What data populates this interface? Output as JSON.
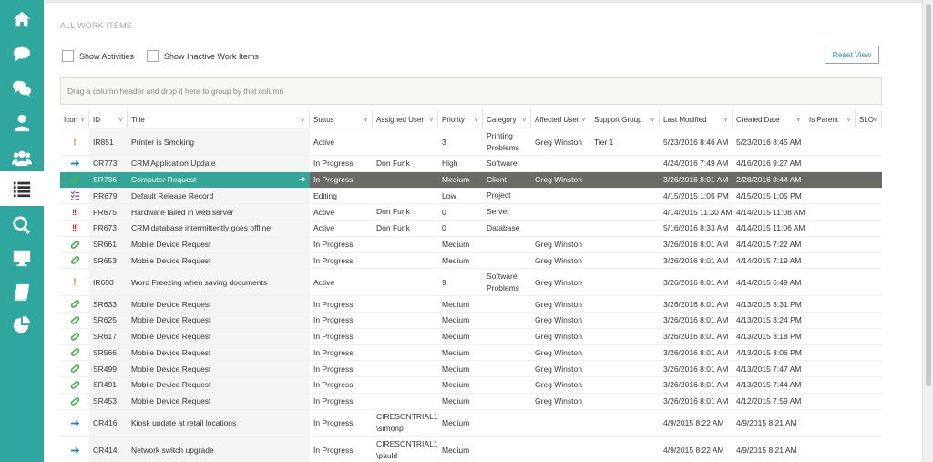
{
  "nav": [
    {
      "name": "home",
      "icon": "home-icon"
    },
    {
      "name": "chat",
      "icon": "chat-bubble-icon"
    },
    {
      "name": "conversations",
      "icon": "chat-bubbles-icon"
    },
    {
      "name": "profile",
      "icon": "user-icon"
    },
    {
      "name": "groups",
      "icon": "users-icon"
    },
    {
      "name": "work-items",
      "icon": "list-icon",
      "active": true
    },
    {
      "name": "search",
      "icon": "search-icon"
    },
    {
      "name": "monitor",
      "icon": "monitor-icon"
    },
    {
      "name": "knowledge",
      "icon": "book-icon"
    },
    {
      "name": "reports",
      "icon": "pie-chart-icon"
    }
  ],
  "page": {
    "title": "ALL WORK ITEMS",
    "show_activities_label": "Show Activities",
    "show_inactive_label": "Show Inactive Work Items",
    "reset_label": "Reset View",
    "group_hint": "Drag a column header and drop it here to group by that column"
  },
  "colors": {
    "sidebar": "#2fa79e",
    "selected_row": "#6b6b66",
    "selected_accent": "#35a597",
    "incident": "#f08a24",
    "problem": "#d9262b",
    "change": "#1e7fc4",
    "service_request": "#4caf50",
    "release": "#7b4fb5"
  },
  "columns": [
    {
      "key": "icon",
      "label": "Icon"
    },
    {
      "key": "id",
      "label": "ID"
    },
    {
      "key": "title",
      "label": "Title"
    },
    {
      "key": "status",
      "label": "Status"
    },
    {
      "key": "assigned",
      "label": "Assigned User"
    },
    {
      "key": "priority",
      "label": "Priority"
    },
    {
      "key": "category",
      "label": "Category"
    },
    {
      "key": "affected",
      "label": "Affected User"
    },
    {
      "key": "group",
      "label": "Support Group"
    },
    {
      "key": "modified",
      "label": "Last Modified"
    },
    {
      "key": "created",
      "label": "Created Date"
    },
    {
      "key": "parent",
      "label": "Is Parent"
    },
    {
      "key": "slo",
      "label": "SLO"
    }
  ],
  "rows": [
    {
      "type": "IR",
      "id": "IR851",
      "title": "Printer is Smoking",
      "status": "Active",
      "assigned": "",
      "priority": "3",
      "category": "Printing Problems",
      "affected": "Greg Winston",
      "group": "Tier 1",
      "modified": "5/23/2016 8:46 AM",
      "created": "5/23/2016 8:45 AM",
      "parent": "",
      "slo": ""
    },
    {
      "type": "CR",
      "id": "CR773",
      "title": "CRM Application Update",
      "status": "In Progress",
      "assigned": "Don Funk",
      "priority": "High",
      "category": "Software",
      "affected": "",
      "group": "",
      "modified": "4/24/2016 7:49 AM",
      "created": "4/16/2016 9:27 AM",
      "parent": "",
      "slo": ""
    },
    {
      "type": "SR",
      "id": "SR736",
      "title": "Computer Request",
      "status": "In Progress",
      "assigned": "",
      "priority": "Medium",
      "category": "Client",
      "affected": "Greg Winston",
      "group": "",
      "modified": "3/26/2016 8:01 AM",
      "created": "2/28/2016 8:44 AM",
      "parent": "",
      "slo": "",
      "selected": true
    },
    {
      "type": "RR",
      "id": "RR679",
      "title": "Default Release Record",
      "status": "Editing",
      "assigned": "",
      "priority": "Low",
      "category": "Project",
      "affected": "",
      "group": "",
      "modified": "4/15/2015 1:05 PM",
      "created": "4/15/2015 1:05 PM",
      "parent": "",
      "slo": ""
    },
    {
      "type": "PR",
      "id": "PR675",
      "title": "Hardware failed in web server",
      "status": "Active",
      "assigned": "Don Funk",
      "priority": "0",
      "category": "Server",
      "affected": "",
      "group": "",
      "modified": "4/14/2015 11:30 AM",
      "created": "4/14/2015 11:08 AM",
      "parent": "",
      "slo": ""
    },
    {
      "type": "PR",
      "id": "PR673",
      "title": "CRM database intermittently goes offline",
      "status": "Active",
      "assigned": "Don Funk",
      "priority": "0",
      "category": "Database",
      "affected": "",
      "group": "",
      "modified": "5/16/2016 8:33 AM",
      "created": "4/14/2015 11:06 AM",
      "parent": "",
      "slo": ""
    },
    {
      "type": "SR",
      "id": "SR661",
      "title": "Mobile Device Request",
      "status": "In Progress",
      "assigned": "",
      "priority": "Medium",
      "category": "",
      "affected": "Greg Winston",
      "group": "",
      "modified": "3/26/2016 8:01 AM",
      "created": "4/14/2015 7:22 AM",
      "parent": "",
      "slo": ""
    },
    {
      "type": "SR",
      "id": "SR653",
      "title": "Mobile Device Request",
      "status": "In Progress",
      "assigned": "",
      "priority": "Medium",
      "category": "",
      "affected": "Greg Winston",
      "group": "",
      "modified": "3/26/2016 8:01 AM",
      "created": "4/14/2015 7:19 AM",
      "parent": "",
      "slo": ""
    },
    {
      "type": "IR",
      "id": "IR650",
      "title": "Word Freezing when saving documents",
      "status": "Active",
      "assigned": "",
      "priority": "9",
      "category": "Software Problems",
      "affected": "Greg Winston",
      "group": "",
      "modified": "3/26/2016 8:01 AM",
      "created": "4/14/2015 6:49 AM",
      "parent": "",
      "slo": ""
    },
    {
      "type": "SR",
      "id": "SR633",
      "title": "Mobile Device Request",
      "status": "In Progress",
      "assigned": "",
      "priority": "Medium",
      "category": "",
      "affected": "Greg Winston",
      "group": "",
      "modified": "3/26/2016 8:01 AM",
      "created": "4/13/2015 3:31 PM",
      "parent": "",
      "slo": ""
    },
    {
      "type": "SR",
      "id": "SR625",
      "title": "Mobile Device Request",
      "status": "In Progress",
      "assigned": "",
      "priority": "Medium",
      "category": "",
      "affected": "Greg Winston",
      "group": "",
      "modified": "3/26/2016 8:01 AM",
      "created": "4/13/2015 3:24 PM",
      "parent": "",
      "slo": ""
    },
    {
      "type": "SR",
      "id": "SR617",
      "title": "Mobile Device Request",
      "status": "In Progress",
      "assigned": "",
      "priority": "Medium",
      "category": "",
      "affected": "Greg Winston",
      "group": "",
      "modified": "3/26/2016 8:01 AM",
      "created": "4/13/2015 3:18 PM",
      "parent": "",
      "slo": ""
    },
    {
      "type": "SR",
      "id": "SR566",
      "title": "Mobile Device Request",
      "status": "In Progress",
      "assigned": "",
      "priority": "Medium",
      "category": "",
      "affected": "Greg Winston",
      "group": "",
      "modified": "3/26/2016 8:01 AM",
      "created": "4/13/2015 3:06 PM",
      "parent": "",
      "slo": ""
    },
    {
      "type": "SR",
      "id": "SR499",
      "title": "Mobile Device Request",
      "status": "In Progress",
      "assigned": "",
      "priority": "Medium",
      "category": "",
      "affected": "Greg Winston",
      "group": "",
      "modified": "3/26/2016 8:01 AM",
      "created": "4/13/2015 7:47 AM",
      "parent": "",
      "slo": ""
    },
    {
      "type": "SR",
      "id": "SR491",
      "title": "Mobile Device Request",
      "status": "In Progress",
      "assigned": "",
      "priority": "Medium",
      "category": "",
      "affected": "Greg Winston",
      "group": "",
      "modified": "3/26/2016 8:01 AM",
      "created": "4/13/2015 7:44 AM",
      "parent": "",
      "slo": ""
    },
    {
      "type": "SR",
      "id": "SR453",
      "title": "Mobile Device Request",
      "status": "In Progress",
      "assigned": "",
      "priority": "Medium",
      "category": "",
      "affected": "Greg Winston",
      "group": "",
      "modified": "3/26/2016 8:01 AM",
      "created": "4/12/2015 7:59 AM",
      "parent": "",
      "slo": ""
    },
    {
      "type": "CR",
      "id": "CR416",
      "title": "Kiosk update at retail locations",
      "status": "In Progress",
      "assigned": "CIRESONTRIAL1 \\simonp",
      "priority": "Medium",
      "category": "",
      "affected": "",
      "group": "",
      "modified": "4/9/2015 8:22 AM",
      "created": "4/9/2015 8:21 AM",
      "parent": "",
      "slo": ""
    },
    {
      "type": "CR",
      "id": "CR414",
      "title": "Network switch upgrade",
      "status": "In Progress",
      "assigned": "CIRESONTRIAL1 \\pauld",
      "priority": "Medium",
      "category": "",
      "affected": "",
      "group": "",
      "modified": "4/9/2015 8:22 AM",
      "created": "4/9/2015 8:21 AM",
      "parent": "",
      "slo": ""
    }
  ]
}
